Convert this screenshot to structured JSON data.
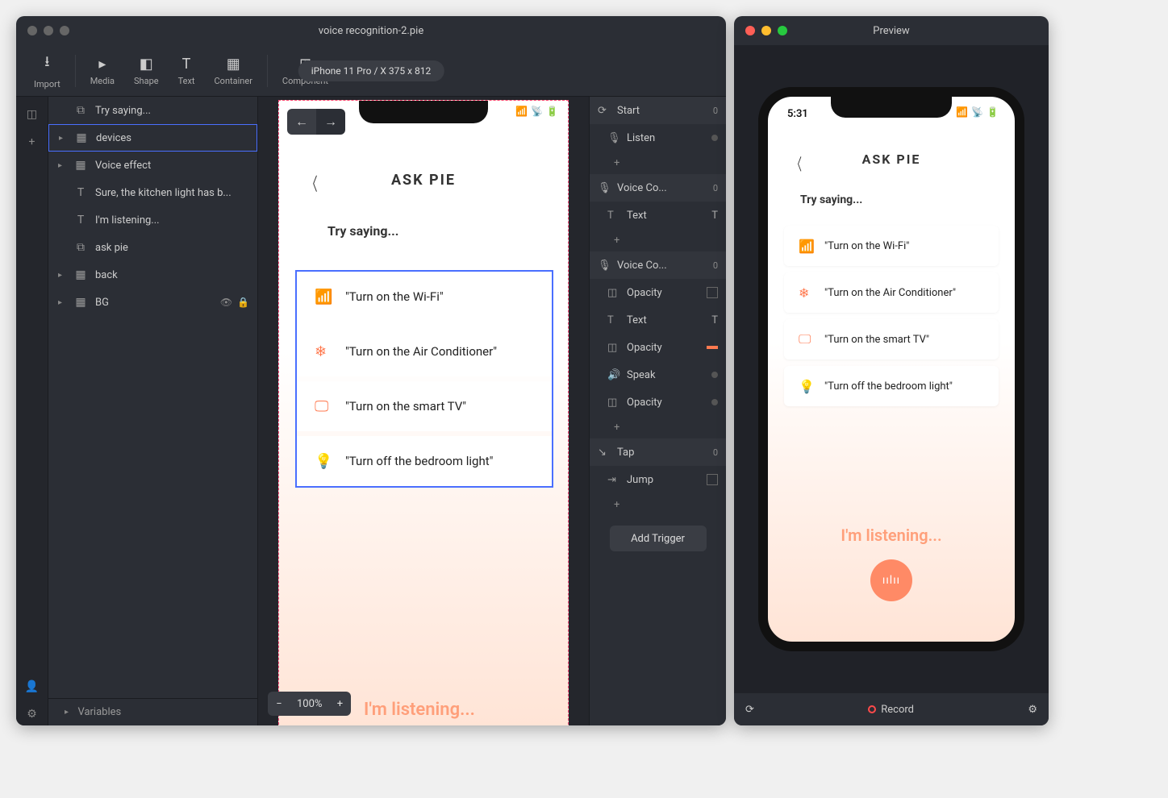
{
  "mainWindow": {
    "title": "voice recognition-2.pie",
    "device": "iPhone 11 Pro / X  375 x 812"
  },
  "toolbar": {
    "import": "Import",
    "media": "Media",
    "shape": "Shape",
    "text": "Text",
    "container": "Container",
    "component": "Component"
  },
  "layers": [
    {
      "label": "Try saying...",
      "icon": "text-container",
      "chevron": false,
      "selected": false
    },
    {
      "label": "devices",
      "icon": "container",
      "chevron": true,
      "selected": true
    },
    {
      "label": "Voice effect",
      "icon": "container",
      "chevron": true,
      "selected": false
    },
    {
      "label": "Sure, the kitchen light has b...",
      "icon": "text",
      "chevron": false,
      "selected": false
    },
    {
      "label": "I'm listening...",
      "icon": "text",
      "chevron": false,
      "selected": false
    },
    {
      "label": "ask pie",
      "icon": "text-container",
      "chevron": false,
      "selected": false
    },
    {
      "label": "back",
      "icon": "container",
      "chevron": true,
      "selected": false
    },
    {
      "label": "BG",
      "icon": "container",
      "chevron": true,
      "selected": false,
      "locked": true
    }
  ],
  "layersFooter": "Variables",
  "canvas": {
    "title": "ASK PIE",
    "trySaying": "Try saying...",
    "cards": [
      {
        "icon": "wifi",
        "label": "\"Turn on the Wi-Fi\""
      },
      {
        "icon": "ac",
        "label": "\"Turn on the Air Conditioner\""
      },
      {
        "icon": "tv",
        "label": "\"Turn on the smart TV\""
      },
      {
        "icon": "bulb",
        "label": "\"Turn off the bedroom light\""
      }
    ],
    "listening": "I'm listening...",
    "zoom": "100%"
  },
  "triggers": {
    "groups": [
      {
        "name": "Start",
        "count": "0",
        "items": [
          {
            "kind": "mic",
            "label": "Listen"
          }
        ]
      },
      {
        "name": "Voice Co...",
        "count": "0",
        "items": [
          {
            "kind": "text",
            "label": "Text",
            "rightIcon": "T"
          }
        ]
      },
      {
        "name": "Voice Co...",
        "count": "0",
        "items": [
          {
            "kind": "opacity",
            "label": "Opacity",
            "right": "box"
          },
          {
            "kind": "text",
            "label": "Text",
            "rightIcon": "T"
          },
          {
            "kind": "opacity",
            "label": "Opacity",
            "right": "bar"
          },
          {
            "kind": "speak",
            "label": "Speak"
          },
          {
            "kind": "opacity",
            "label": "Opacity"
          }
        ]
      },
      {
        "name": "Tap",
        "count": "0",
        "items": [
          {
            "kind": "jump",
            "label": "Jump",
            "right": "box"
          }
        ]
      }
    ],
    "addTrigger": "Add Trigger"
  },
  "preview": {
    "title": "Preview",
    "time": "5:31",
    "askTitle": "ASK PIE",
    "trySaying": "Try saying...",
    "cards": [
      {
        "icon": "wifi",
        "label": "\"Turn on the Wi-Fi\""
      },
      {
        "icon": "ac",
        "label": "\"Turn on the Air Conditioner\""
      },
      {
        "icon": "tv",
        "label": "\"Turn on the smart TV\""
      },
      {
        "icon": "bulb",
        "label": "\"Turn off the bedroom light\""
      }
    ],
    "listening": "I'm listening...",
    "recordLabel": "Record"
  }
}
